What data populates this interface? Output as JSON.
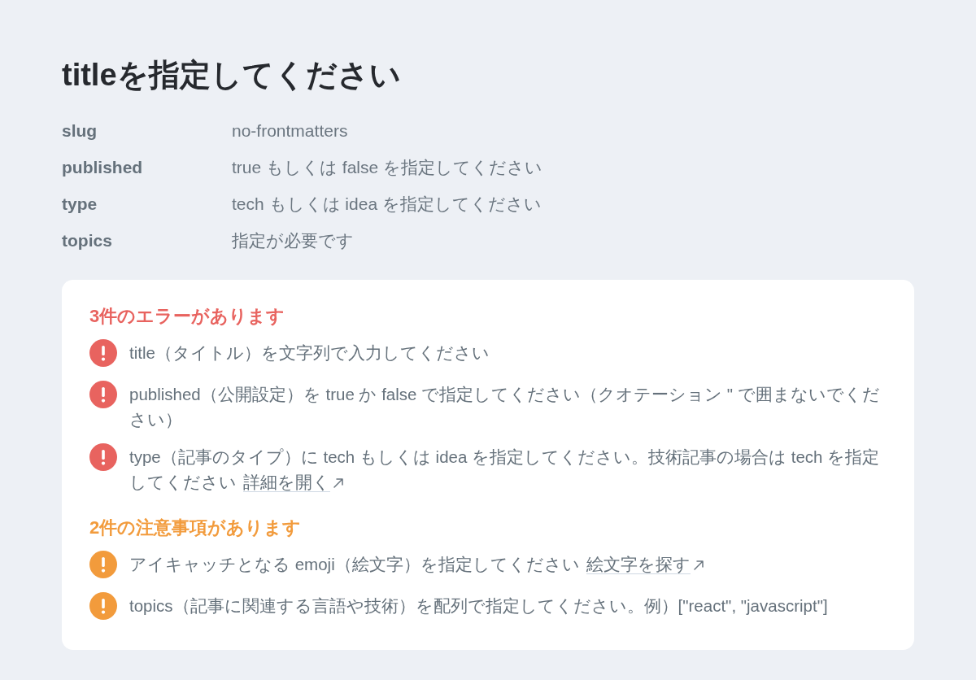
{
  "page": {
    "title": "titleを指定してください"
  },
  "fields": [
    {
      "label": "slug",
      "value": "no-frontmatters"
    },
    {
      "label": "published",
      "value": "true もしくは false を指定してください"
    },
    {
      "label": "type",
      "value": "tech もしくは idea を指定してください"
    },
    {
      "label": "topics",
      "value": "指定が必要です"
    }
  ],
  "issues": [
    {
      "kind": "error",
      "heading": "3件のエラーがあります",
      "items": [
        {
          "text": "title（タイトル）を文字列で入力してください"
        },
        {
          "text": "published（公開設定）を true か false で指定してください（クオテーション \" で囲まないでください）"
        },
        {
          "text": "type（記事のタイプ）に tech もしくは idea を指定してください。技術記事の場合は tech を指定してください",
          "link": "詳細を開く"
        }
      ]
    },
    {
      "kind": "warning",
      "heading": "2件の注意事項があります",
      "items": [
        {
          "text": "アイキャッチとなる emoji（絵文字）を指定してください",
          "link": "絵文字を探す"
        },
        {
          "text": "topics（記事に関連する言語や技術）を配列で指定してください。例）[\"react\", \"javascript\"]"
        }
      ]
    }
  ]
}
